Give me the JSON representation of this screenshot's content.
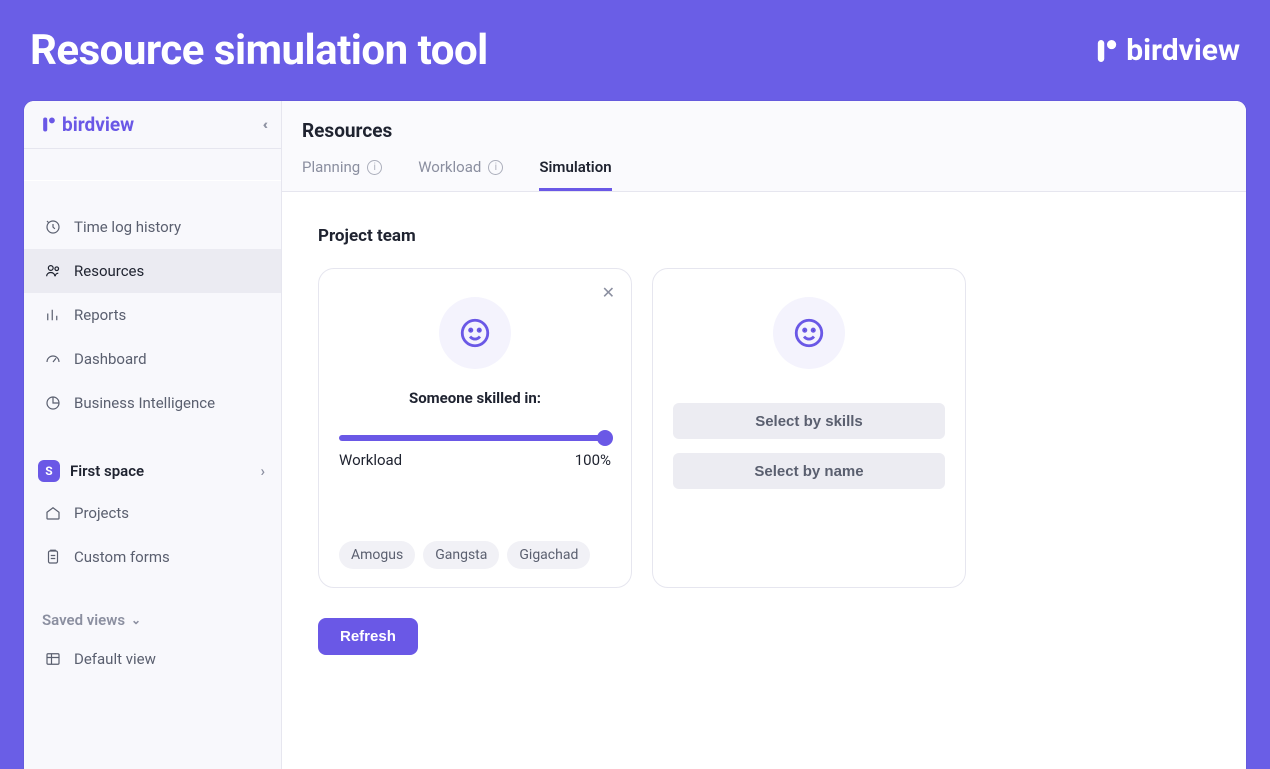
{
  "banner": {
    "title": "Resource simulation tool",
    "brand": "birdview"
  },
  "sidebar": {
    "brand": "birdview",
    "nav": [
      {
        "label": "Time log history"
      },
      {
        "label": "Resources"
      },
      {
        "label": "Reports"
      },
      {
        "label": "Dashboard"
      },
      {
        "label": "Business Intelligence"
      }
    ],
    "space": {
      "badge": "S",
      "label": "First space"
    },
    "space_children": [
      {
        "label": "Projects"
      },
      {
        "label": "Custom forms"
      }
    ],
    "saved_views_label": "Saved views",
    "default_view_label": "Default view"
  },
  "main": {
    "page_title": "Resources",
    "tabs": [
      {
        "label": "Planning",
        "info": true
      },
      {
        "label": "Workload",
        "info": true
      },
      {
        "label": "Simulation",
        "info": false
      }
    ],
    "active_tab_index": 2,
    "section_title": "Project team",
    "card1": {
      "heading": "Someone skilled in:",
      "slider_label": "Workload",
      "slider_value": "100%",
      "skills": [
        "Amogus",
        "Gangsta",
        "Gigachad"
      ]
    },
    "card2": {
      "btn_skills": "Select by skills",
      "btn_name": "Select by name"
    },
    "refresh_label": "Refresh"
  }
}
